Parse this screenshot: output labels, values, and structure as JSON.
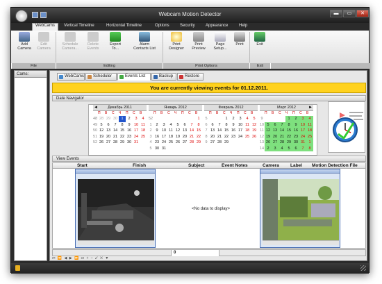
{
  "window": {
    "title": "Webcam Motion Detector",
    "min": "▬",
    "max": "▭",
    "close": "✕"
  },
  "menu_tabs": [
    {
      "label": "WebCams",
      "key": "A"
    },
    {
      "label": "Vertical Timeline",
      "key": "V"
    },
    {
      "label": "Horizontal Timeline",
      "key": "H"
    },
    {
      "label": "Options",
      "key": "O"
    },
    {
      "label": "Security",
      "key": "S"
    },
    {
      "label": "Appearance",
      "key": "C"
    },
    {
      "label": "Help",
      "key": "P"
    }
  ],
  "ribbon": {
    "buttons": [
      {
        "label": "Add\nCamera",
        "icon": "add-camera-icon",
        "enabled": true
      },
      {
        "label": "Edit\nCamera",
        "icon": "edit-camera-icon",
        "enabled": false
      },
      {
        "label": "Schedule\nCamera...",
        "icon": "schedule-camera-icon",
        "enabled": false
      },
      {
        "label": "Delete\nEvents",
        "icon": "delete-events-icon",
        "enabled": false
      },
      {
        "label": "Export\nTo...",
        "icon": "export-icon",
        "enabled": true
      },
      {
        "label": "Alarm\nContacts List",
        "icon": "alarm-contacts-icon",
        "enabled": true
      },
      {
        "label": "Print\nDesigner",
        "icon": "print-designer-icon",
        "enabled": true
      },
      {
        "label": "Print\nPreview",
        "icon": "print-preview-icon",
        "enabled": true
      },
      {
        "label": "Page\nSetup...",
        "icon": "page-setup-icon",
        "enabled": true
      },
      {
        "label": "Print",
        "icon": "print-icon",
        "enabled": true
      },
      {
        "label": "Exit",
        "icon": "exit-icon",
        "enabled": true
      }
    ],
    "groups": [
      "File",
      "Editing",
      "Print Options",
      "Exit"
    ]
  },
  "sidebar": {
    "header": "Cams:"
  },
  "content_tabs": [
    {
      "label": "WebCams",
      "icon": "webcam-icon"
    },
    {
      "label": "Scheduler",
      "icon": "scheduler-icon"
    },
    {
      "label": "Events List",
      "icon": "events-list-icon"
    },
    {
      "label": "Backup",
      "icon": "backup-icon"
    },
    {
      "label": "Restore",
      "icon": "restore-icon"
    }
  ],
  "banner": "You are currently viewing events for 01.12.2011.",
  "date_navigator": {
    "title": "Date Navigator",
    "prev": "◄",
    "next": "►",
    "dow": [
      "П",
      "В",
      "С",
      "Ч",
      "П",
      "С",
      "В"
    ],
    "months": [
      {
        "title": "Декабрь 2011",
        "weeks": [
          {
            "no": "48",
            "days": [
              "28",
              "29",
              "30",
              "1",
              "2",
              "3",
              "4"
            ]
          },
          {
            "no": "49",
            "days": [
              "5",
              "6",
              "7",
              "8",
              "9",
              "10",
              "11"
            ]
          },
          {
            "no": "50",
            "days": [
              "12",
              "13",
              "14",
              "15",
              "16",
              "17",
              "18"
            ]
          },
          {
            "no": "51",
            "days": [
              "19",
              "20",
              "21",
              "22",
              "23",
              "24",
              "25"
            ]
          },
          {
            "no": "52",
            "days": [
              "26",
              "27",
              "28",
              "29",
              "30",
              "31",
              ""
            ]
          },
          {
            "no": "",
            "days": [
              "",
              "",
              "",
              "",
              "",
              "",
              ""
            ]
          }
        ]
      },
      {
        "title": "Январь 2012",
        "weeks": [
          {
            "no": "52",
            "days": [
              "",
              "",
              "",
              "",
              "",
              "",
              "1"
            ]
          },
          {
            "no": "1",
            "days": [
              "2",
              "3",
              "4",
              "5",
              "6",
              "7",
              "8"
            ]
          },
          {
            "no": "2",
            "days": [
              "9",
              "10",
              "11",
              "12",
              "13",
              "14",
              "15"
            ]
          },
          {
            "no": "3",
            "days": [
              "16",
              "17",
              "18",
              "19",
              "20",
              "21",
              "22"
            ]
          },
          {
            "no": "4",
            "days": [
              "23",
              "24",
              "25",
              "26",
              "27",
              "28",
              "29"
            ]
          },
          {
            "no": "5",
            "days": [
              "30",
              "31",
              "",
              "",
              "",
              "",
              ""
            ]
          }
        ]
      },
      {
        "title": "Февраль 2012",
        "weeks": [
          {
            "no": "5",
            "days": [
              "",
              "",
              "1",
              "2",
              "3",
              "4",
              "5"
            ]
          },
          {
            "no": "6",
            "days": [
              "6",
              "7",
              "8",
              "9",
              "10",
              "11",
              "12"
            ]
          },
          {
            "no": "7",
            "days": [
              "13",
              "14",
              "15",
              "16",
              "17",
              "18",
              "19"
            ]
          },
          {
            "no": "8",
            "days": [
              "20",
              "21",
              "22",
              "23",
              "24",
              "25",
              "26"
            ]
          },
          {
            "no": "9",
            "days": [
              "27",
              "28",
              "29",
              "",
              "",
              "",
              ""
            ]
          },
          {
            "no": "",
            "days": [
              "",
              "",
              "",
              "",
              "",
              "",
              ""
            ]
          }
        ]
      },
      {
        "title": "Март 2012",
        "weeks": [
          {
            "no": "9",
            "days": [
              "",
              "",
              "",
              "1",
              "2",
              "3",
              "4"
            ]
          },
          {
            "no": "10",
            "days": [
              "5",
              "6",
              "7",
              "8",
              "9",
              "10",
              "11"
            ]
          },
          {
            "no": "11",
            "days": [
              "12",
              "13",
              "14",
              "15",
              "16",
              "17",
              "18"
            ]
          },
          {
            "no": "12",
            "days": [
              "19",
              "20",
              "21",
              "22",
              "23",
              "24",
              "25"
            ]
          },
          {
            "no": "13",
            "days": [
              "26",
              "27",
              "28",
              "29",
              "30",
              "31",
              "1"
            ]
          },
          {
            "no": "14",
            "days": [
              "2",
              "3",
              "4",
              "5",
              "6",
              "7",
              "8"
            ]
          }
        ]
      }
    ]
  },
  "view_events": {
    "title": "View Events",
    "columns": [
      "Start",
      "Finish",
      "Subject",
      "Event Notes",
      "Camera",
      "Label",
      "Motion Detection File"
    ],
    "empty_text": "<No data to display>",
    "footer_count": "0",
    "pager": "⏮ ⏪ ◀ ▶ ⏩ ⏭ + – ✓ ✕ ▼"
  }
}
